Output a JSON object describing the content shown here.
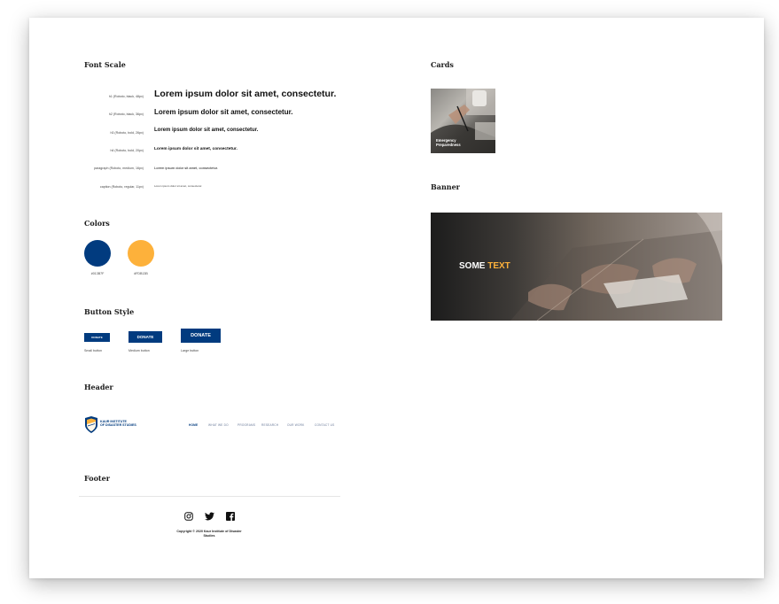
{
  "sections": {
    "font_scale": "Font Scale",
    "colors": "Colors",
    "button_style": "Button Style",
    "header": "Header",
    "footer": "Footer",
    "cards": "Cards",
    "banner": "Banner"
  },
  "font_scale": [
    {
      "label": "h1 (Roboto, black, 48px)",
      "sample": "Lorem ipsum dolor sit amet, consectetur."
    },
    {
      "label": "h2 (Roboto, black, 36px)",
      "sample": "Lorem ipsum dolor sit amet, consectetur."
    },
    {
      "label": "h3 (Roboto, bold, 26px)",
      "sample": "Lorem ipsum dolor sit amet, consectetur."
    },
    {
      "label": "h4 (Roboto, bold, 20px)",
      "sample": "Lorem ipsum dolor sit amet, consectetur."
    },
    {
      "label": "paragraph (Roboto, medium, 16px)",
      "sample": "Lorem ipsum dolor sit amet, consectetur."
    },
    {
      "label": "caption (Roboto, regular, 11px)",
      "sample": "Lorem ipsum dolor sit amet, consectetur."
    }
  ],
  "colors": [
    {
      "hex": "#013B7F",
      "label": "#013B7F"
    },
    {
      "hex": "#FDB13B",
      "label": "#FDB13B"
    }
  ],
  "buttons": {
    "small": {
      "label": "DONATE",
      "caption": "Small button"
    },
    "medium": {
      "label": "DONATE",
      "caption": "Medium button"
    },
    "large": {
      "label": "DONATE",
      "caption": "Large button"
    }
  },
  "header": {
    "logo_line1": "KAUR INSTITUTE",
    "logo_line2": "OF DISASTER STUDIES",
    "nav": [
      "HOME",
      "WHAT WE DO",
      "PROGRAMS",
      "RESEARCH",
      "OUR WORK",
      "CONTACT US"
    ]
  },
  "footer": {
    "icons": [
      "instagram-icon",
      "twitter-icon",
      "facebook-icon"
    ],
    "copyright_line1": "Copyright © 2020 Kaur Institute of Disaster",
    "copyright_line2": "Studies"
  },
  "card": {
    "line1": "Emergency",
    "line2": "Preparedness"
  },
  "banner": {
    "text_white": "SOME",
    "text_accent": "TEXT"
  },
  "theme": {
    "primary": "#013B7F",
    "accent": "#FDB13B"
  }
}
